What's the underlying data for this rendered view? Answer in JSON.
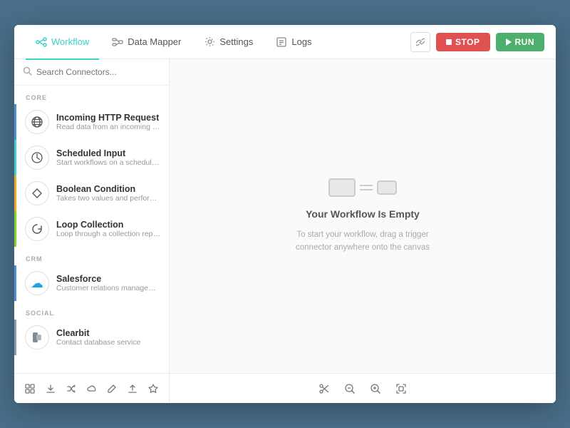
{
  "nav": {
    "tabs": [
      {
        "id": "workflow",
        "label": "Workflow",
        "active": true
      },
      {
        "id": "data-mapper",
        "label": "Data Mapper",
        "active": false
      },
      {
        "id": "settings",
        "label": "Settings",
        "active": false
      },
      {
        "id": "logs",
        "label": "Logs",
        "active": false
      }
    ],
    "stop_label": "STOP",
    "run_label": "RUN"
  },
  "sidebar": {
    "search_placeholder": "Search Connectors...",
    "sections": [
      {
        "label": "CORE",
        "connectors": [
          {
            "name": "Incoming HTTP Request",
            "desc": "Read data from an incoming HTT...",
            "color": "blue",
            "icon": "🌐"
          },
          {
            "name": "Scheduled Input",
            "desc": "Start workflows on a schedule us...",
            "color": "teal",
            "icon": "⏰"
          },
          {
            "name": "Boolean Condition",
            "desc": "Takes two values and performs a...",
            "color": "yellow",
            "icon": "⇄"
          },
          {
            "name": "Loop Collection",
            "desc": "Loop through a collection repeati...",
            "color": "green",
            "icon": "↺"
          }
        ]
      },
      {
        "label": "CRM",
        "connectors": [
          {
            "name": "Salesforce",
            "desc": "Customer relations management ...",
            "color": "blue",
            "icon": "cloud"
          }
        ]
      },
      {
        "label": "SOCIAL",
        "connectors": [
          {
            "name": "Clearbit",
            "desc": "Contact database service",
            "color": "gray",
            "icon": "clearbit"
          }
        ]
      }
    ]
  },
  "canvas": {
    "empty_title": "Your Workflow Is Empty",
    "empty_desc": "To start your workflow, drag a trigger\nconnector anywhere onto the canvas"
  },
  "bottom_toolbar": {
    "left_buttons": [
      "grid-icon",
      "download-icon",
      "shuffle-icon",
      "cloud-icon",
      "pencil-icon",
      "upload-icon",
      "star-icon"
    ],
    "right_buttons": [
      "scissors-icon",
      "zoom-out-icon",
      "zoom-in-icon",
      "fit-icon"
    ]
  }
}
